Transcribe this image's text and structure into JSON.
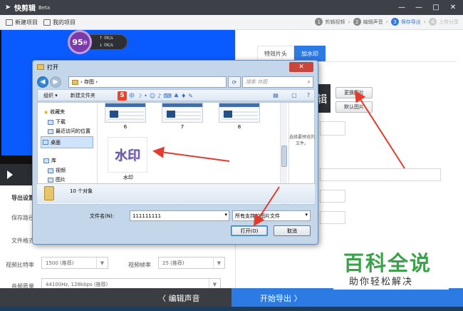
{
  "app": {
    "logo_icon": "play-arrow-icon",
    "name": "快剪辑",
    "beta": "Beta",
    "window_controls": [
      "—",
      "—",
      "□",
      "✕"
    ]
  },
  "toolbar": {
    "new_project": "新建项目",
    "my_projects": "我的项目"
  },
  "steps": [
    {
      "num": "1",
      "label": "剪辑视频"
    },
    {
      "num": "2",
      "label": "编辑声音"
    },
    {
      "num": "3",
      "label": "保存导出"
    },
    {
      "num": "4",
      "label": "上传分享"
    }
  ],
  "speed": {
    "score": "95",
    "unit": "分",
    "up": "0K/s",
    "down": "0K/s"
  },
  "export_panel": {
    "title": "导出设置",
    "save_path_label": "保存路径",
    "format_label": "文件格式",
    "bitrate_label": "视频比特率",
    "bitrate_value": "1500 (推荐)",
    "framerate_label": "视频帧率",
    "framerate_value": "25 (推荐)",
    "audio_label": "音频质量",
    "audio_value": "44100Hz, 128kbps (推荐)"
  },
  "right_panel": {
    "tabs": [
      "特效片头",
      "加水印"
    ],
    "watermark_text": "辑",
    "change_image": "更换图片",
    "default_image": "默认图片"
  },
  "bottom": {
    "edit_audio": "〈 编辑声音",
    "start_export": "开始导出 〉"
  },
  "dialog": {
    "title": "打开",
    "path_root": "存图",
    "search_placeholder": "搜索 存图",
    "organize": "组织 ▾",
    "new_folder": "新建文件夹",
    "nav": {
      "favorites": "收藏夹",
      "downloads": "下载",
      "recent": "最近访问的位置",
      "desktop": "桌面",
      "libraries": "库",
      "videos": "视频",
      "pictures": "图片"
    },
    "files": [
      {
        "name": "6"
      },
      {
        "name": "7"
      },
      {
        "name": "8"
      },
      {
        "name": "水印",
        "thumb_text": "水印"
      }
    ],
    "preview_hint": "选择要预览的文件。",
    "count": "10 个对象",
    "filename_label": "文件名(N):",
    "filename_value": "111111111",
    "filetype_value": "所有支持的图片文件",
    "open_button": "打开(O)",
    "cancel_button": "取消"
  },
  "baike": {
    "title": "百科全说",
    "subtitle": "助你轻松解决"
  }
}
